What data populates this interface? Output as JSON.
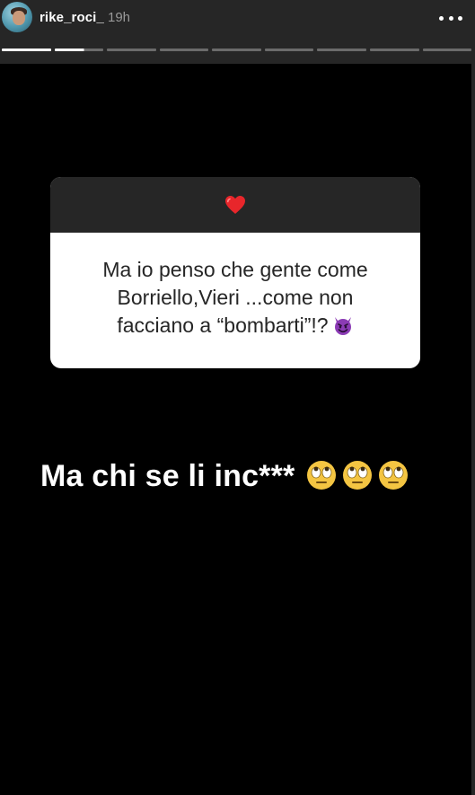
{
  "header": {
    "username": "rike_roci_",
    "timestamp": "19h",
    "avatar_icon": "profile-photo",
    "more_icon": "more-horizontal-icon"
  },
  "progress": {
    "segments": 9,
    "completed": 1,
    "active_index": 1,
    "active_fraction": 0.6
  },
  "question_card": {
    "icon": "heart-icon",
    "question_line_1": "Ma io penso che gente come",
    "question_line_2": "Borriello,Vieri ...come non",
    "question_line_3": "facciano a “bombarti”!?",
    "trailing_emoji": "smiling-devil-icon"
  },
  "answer": {
    "text": "Ma chi se li inc***",
    "emoji": [
      "face-with-rolling-eyes-icon",
      "face-with-rolling-eyes-icon",
      "face-with-rolling-eyes-icon"
    ]
  },
  "colors": {
    "background": "#262626",
    "story_background": "#000000",
    "card_header": "#262626",
    "card_body": "#ffffff",
    "heart": "#e8262b",
    "devil": "#8b3bb5"
  }
}
